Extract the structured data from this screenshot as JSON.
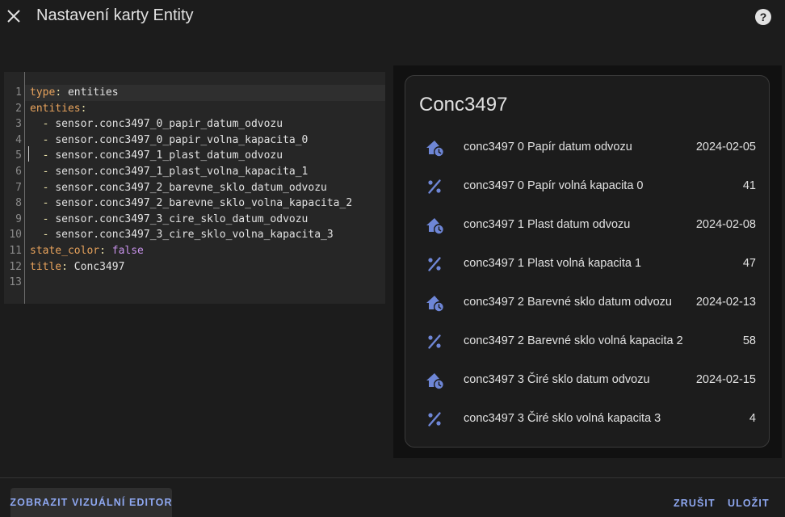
{
  "dialog": {
    "title": "Nastavení karty Entity",
    "close_icon": "close-icon",
    "help_icon": "help-circle-icon"
  },
  "editor": {
    "lines": [
      {
        "num": "1",
        "key": "type",
        "value": "entities",
        "value_kind": "plain"
      },
      {
        "num": "2",
        "key": "entities",
        "value": "",
        "value_kind": "plain"
      },
      {
        "num": "3",
        "item": "sensor.conc3497_0_papir_datum_odvozu"
      },
      {
        "num": "4",
        "item": "sensor.conc3497_0_papir_volna_kapacita_0"
      },
      {
        "num": "5",
        "item": "sensor.conc3497_1_plast_datum_odvozu"
      },
      {
        "num": "6",
        "item": "sensor.conc3497_1_plast_volna_kapacita_1"
      },
      {
        "num": "7",
        "item": "sensor.conc3497_2_barevne_sklo_datum_odvozu"
      },
      {
        "num": "8",
        "item": "sensor.conc3497_2_barevne_sklo_volna_kapacita_2"
      },
      {
        "num": "9",
        "item": "sensor.conc3497_3_cire_sklo_datum_odvozu"
      },
      {
        "num": "10",
        "item": "sensor.conc3497_3_cire_sklo_volna_kapacita_3"
      },
      {
        "num": "11",
        "key": "state_color",
        "value": "false",
        "value_kind": "bool"
      },
      {
        "num": "12",
        "key": "title",
        "value": "Conc3497",
        "value_kind": "plain"
      },
      {
        "num": "13"
      }
    ]
  },
  "card": {
    "title": "Conc3497",
    "entities": [
      {
        "icon": "home-clock-icon",
        "name": "conc3497 0 Papír datum odvozu",
        "state": "2024-02-05"
      },
      {
        "icon": "percent-icon",
        "name": "conc3497 0 Papír volná kapacita 0",
        "state": "41"
      },
      {
        "icon": "home-clock-icon",
        "name": "conc3497 1 Plast datum odvozu",
        "state": "2024-02-08"
      },
      {
        "icon": "percent-icon",
        "name": "conc3497 1 Plast volná kapacita 1",
        "state": "47"
      },
      {
        "icon": "home-clock-icon",
        "name": "conc3497 2 Barevné sklo datum odvozu",
        "state": "2024-02-13"
      },
      {
        "icon": "percent-icon",
        "name": "conc3497 2 Barevné sklo volná kapacita 2",
        "state": "58"
      },
      {
        "icon": "home-clock-icon",
        "name": "conc3497 3 Čiré sklo datum odvozu",
        "state": "2024-02-15"
      },
      {
        "icon": "percent-icon",
        "name": "conc3497 3 Čiré sklo volná kapacita 3",
        "state": "4"
      }
    ]
  },
  "footer": {
    "visual_editor_label": "ZOBRAZIT VIZUÁLNÍ EDITOR",
    "cancel_label": "ZRUŠIT",
    "save_label": "ULOŽIT"
  },
  "colors": {
    "background": "#1c1c1c",
    "preview_background": "#111111",
    "accent": "#8ea7f0",
    "icon": "#6e86d6",
    "yaml_key": "#e8a35c",
    "yaml_bool": "#c792ea"
  }
}
